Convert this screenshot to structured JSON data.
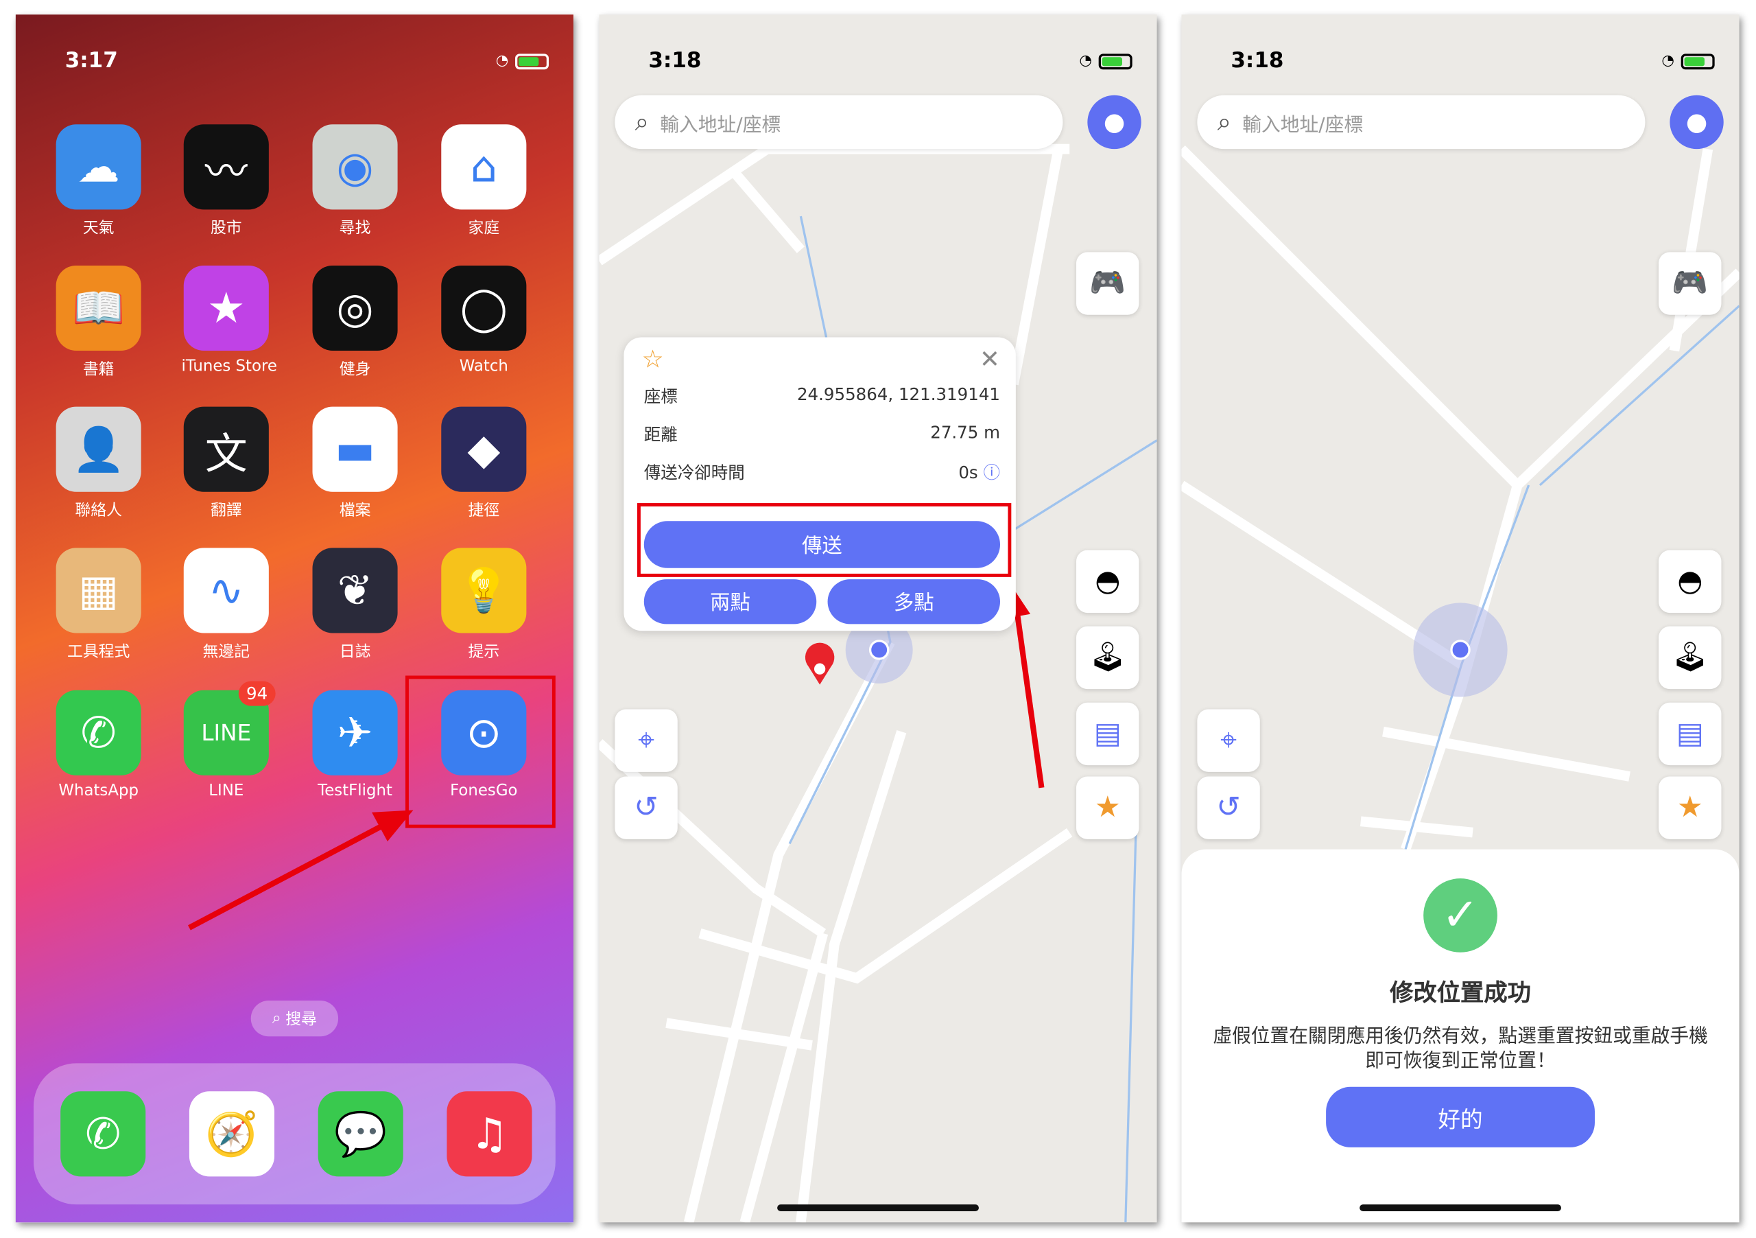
{
  "panel1": {
    "time": "3:17",
    "apps": [
      {
        "label": "天氣",
        "icon": "weather-icon",
        "color": "#3a8ce8"
      },
      {
        "label": "股市",
        "icon": "stocks-icon",
        "color": "#111111"
      },
      {
        "label": "尋找",
        "icon": "find-my-icon",
        "color": "#cfd3cf"
      },
      {
        "label": "家庭",
        "icon": "home-icon",
        "color": "#ffffff"
      },
      {
        "label": "書籍",
        "icon": "books-icon",
        "color": "#f08a1e"
      },
      {
        "label": "iTunes Store",
        "icon": "itunes-star-icon",
        "color": "#c042e6"
      },
      {
        "label": "健身",
        "icon": "fitness-rings-icon",
        "color": "#111111"
      },
      {
        "label": "Watch",
        "icon": "watch-icon",
        "color": "#111111"
      },
      {
        "label": "聯絡人",
        "icon": "contacts-icon",
        "color": "#d8d8d8"
      },
      {
        "label": "翻譯",
        "icon": "translate-icon",
        "color": "#1c1c1e"
      },
      {
        "label": "檔案",
        "icon": "files-folder-icon",
        "color": "#ffffff"
      },
      {
        "label": "捷徑",
        "icon": "shortcuts-icon",
        "color": "#2b2a5c"
      },
      {
        "label": "工具程式",
        "icon": "utilities-folder-icon",
        "color": "#e8b87a"
      },
      {
        "label": "無邊記",
        "icon": "freeform-icon",
        "color": "#ffffff"
      },
      {
        "label": "日誌",
        "icon": "journal-icon",
        "color": "#2a2a3a"
      },
      {
        "label": "提示",
        "icon": "tips-bulb-icon",
        "color": "#f6c21b"
      },
      {
        "label": "WhatsApp",
        "icon": "whatsapp-icon",
        "color": "#33c84f"
      },
      {
        "label": "LINE",
        "icon": "line-icon",
        "color": "#36c24a",
        "badge": "94"
      },
      {
        "label": "TestFlight",
        "icon": "testflight-icon",
        "color": "#2f8cf0"
      },
      {
        "label": "FonesGo",
        "icon": "fonesgo-pin-icon",
        "color": "#3a7ef0"
      }
    ],
    "search_label": "搜尋",
    "dock": [
      {
        "icon": "phone-icon",
        "color": "#39c94e"
      },
      {
        "icon": "safari-icon",
        "color": "#ffffff"
      },
      {
        "icon": "messages-icon",
        "color": "#39c94e"
      },
      {
        "icon": "music-icon",
        "color": "#f2394b"
      }
    ]
  },
  "panel2": {
    "time": "3:18",
    "search_placeholder": "輸入地址/座標",
    "popup": {
      "coord_label": "座標",
      "coord_value": "24.955864, 121.319141",
      "distance_label": "距離",
      "distance_value": "27.75 m",
      "cooldown_label": "傳送冷卻時間",
      "cooldown_value": "0s",
      "teleport_button": "傳送",
      "two_point_button": "兩點",
      "multi_point_button": "多點"
    }
  },
  "panel3": {
    "time": "3:18",
    "search_placeholder": "輸入地址/座標",
    "success_title": "修改位置成功",
    "success_message": "虛假位置在關閉應用後仍然有效，點選重置按鈕或重啟手機即可恢復到正常位置！",
    "ok_button": "好的"
  },
  "colors": {
    "accent": "#5f72f5",
    "success": "#5fcf7e",
    "annotation": "#e8000b"
  }
}
